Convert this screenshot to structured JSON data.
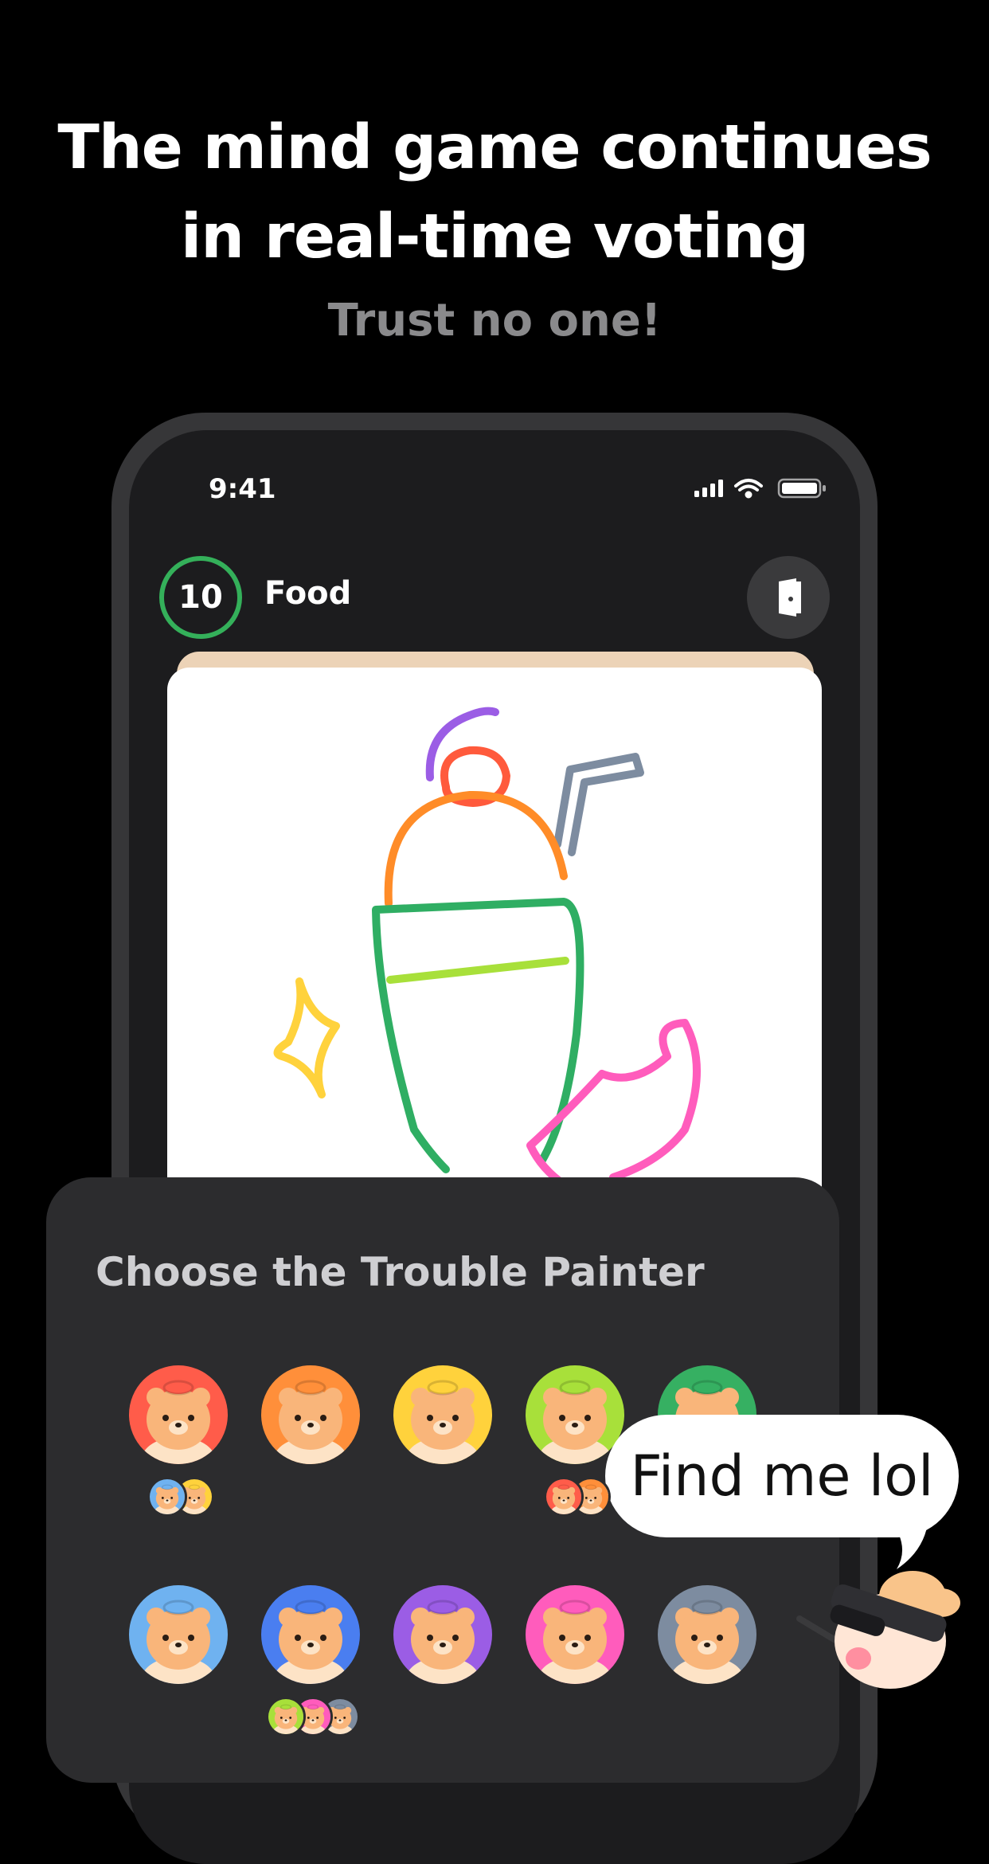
{
  "headline": {
    "line1": "The mind game continues",
    "line2": "in real-time voting"
  },
  "subline": "Trust no one!",
  "status_bar": {
    "time": "9:41",
    "icons": [
      "signal-icon",
      "wifi-icon",
      "battery-icon"
    ]
  },
  "game_header": {
    "timer_value": "10",
    "topic": "Food",
    "exit_icon": "door-exit-icon",
    "timer_color": "#34b05a"
  },
  "drawing": {
    "subject": "milkshake-drawing",
    "stroke_colors": [
      "#9b5de5",
      "#ff5a3c",
      "#ff8c28",
      "#7d8ca0",
      "#2fae63",
      "#a8e03a",
      "#ffd23c",
      "#ff5cbc"
    ]
  },
  "vote_sheet": {
    "title": "Choose the Trouble Painter",
    "players": [
      {
        "name": "red",
        "color": "#ff5c4a",
        "votes": [
          "blue",
          "yellow"
        ]
      },
      {
        "name": "orange",
        "color": "#ff8f3a",
        "votes": []
      },
      {
        "name": "yellow",
        "color": "#ffd23c",
        "votes": []
      },
      {
        "name": "lime",
        "color": "#a8e03a",
        "votes": [
          "red",
          "orange"
        ]
      },
      {
        "name": "green",
        "color": "#36b062",
        "votes": []
      },
      {
        "name": "blue",
        "color": "#6fb2f0",
        "votes": []
      },
      {
        "name": "navy",
        "color": "#4a7ef0",
        "votes": [
          "lime",
          "pink",
          "gray"
        ]
      },
      {
        "name": "purple",
        "color": "#9b5de5",
        "votes": []
      },
      {
        "name": "pink",
        "color": "#ff5cbc",
        "votes": []
      },
      {
        "name": "gray",
        "color": "#7d8ca0",
        "votes": []
      }
    ]
  },
  "speech_bubble": "Find me lol",
  "mascot_icon": "disguised-hamster-icon"
}
